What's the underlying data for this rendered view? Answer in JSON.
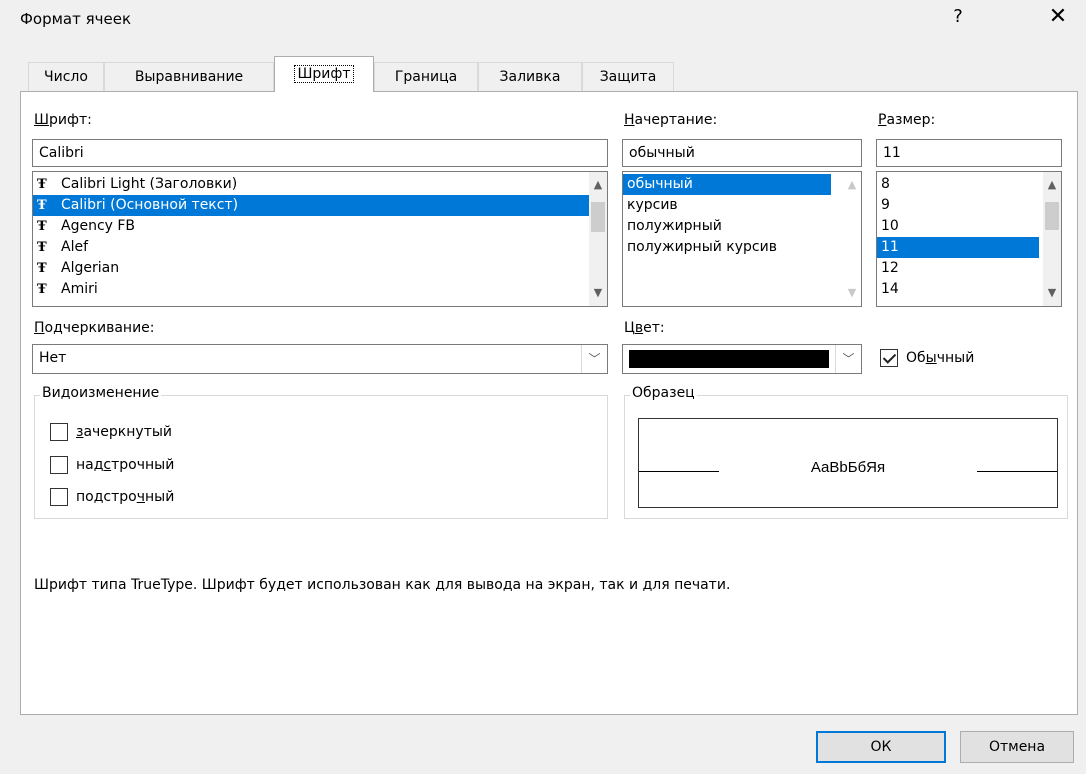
{
  "window": {
    "title": "Формат ячеек",
    "help_glyph": "?",
    "close_glyph": "✕"
  },
  "tabs": [
    {
      "label": "Число"
    },
    {
      "label": "Выравнивание"
    },
    {
      "label": "Шрифт"
    },
    {
      "label": "Граница"
    },
    {
      "label": "Заливка"
    },
    {
      "label": "Защита"
    }
  ],
  "font": {
    "label_accel": "Ш",
    "label_rest": "рифт:",
    "value": "Calibri",
    "items": [
      "Calibri Light (Заголовки)",
      "Calibri (Основной текст)",
      "Agency FB",
      "Alef",
      "Algerian",
      "Amiri"
    ],
    "tt_glyph": "Ŧ"
  },
  "style": {
    "label_accel": "Н",
    "label_rest": "ачертание:",
    "value": "обычный",
    "items": [
      "обычный",
      "курсив",
      "полужирный",
      "полужирный курсив"
    ]
  },
  "size": {
    "label_accel": "Р",
    "label_rest": "азмер:",
    "value": "11",
    "items": [
      "8",
      "9",
      "10",
      "11",
      "12",
      "14"
    ]
  },
  "underline": {
    "label_accel": "П",
    "label_rest": "одчеркивание:",
    "value": "Нет"
  },
  "color": {
    "label_pre": "Ц",
    "label_accel": "в",
    "label_rest": "ет:",
    "swatch": "#000000",
    "normal_pre": "Об",
    "normal_accel": "ы",
    "normal_rest": "чный"
  },
  "effects": {
    "title": "Видоизменение",
    "strike_accel": "з",
    "strike_rest": "ачеркнутый",
    "super_pre": "над",
    "super_accel": "с",
    "super_rest": "трочный",
    "sub_pre": "подстро",
    "sub_accel": "ч",
    "sub_rest": "ный"
  },
  "preview": {
    "title": "Образец",
    "text": "АаBbБбЯя"
  },
  "description": "Шрифт типа TrueType. Шрифт будет использован как для вывода на экран, так и для печати.",
  "buttons": {
    "ok": "ОК",
    "cancel": "Отмена"
  },
  "colors": {
    "selection": "#0078d7"
  }
}
